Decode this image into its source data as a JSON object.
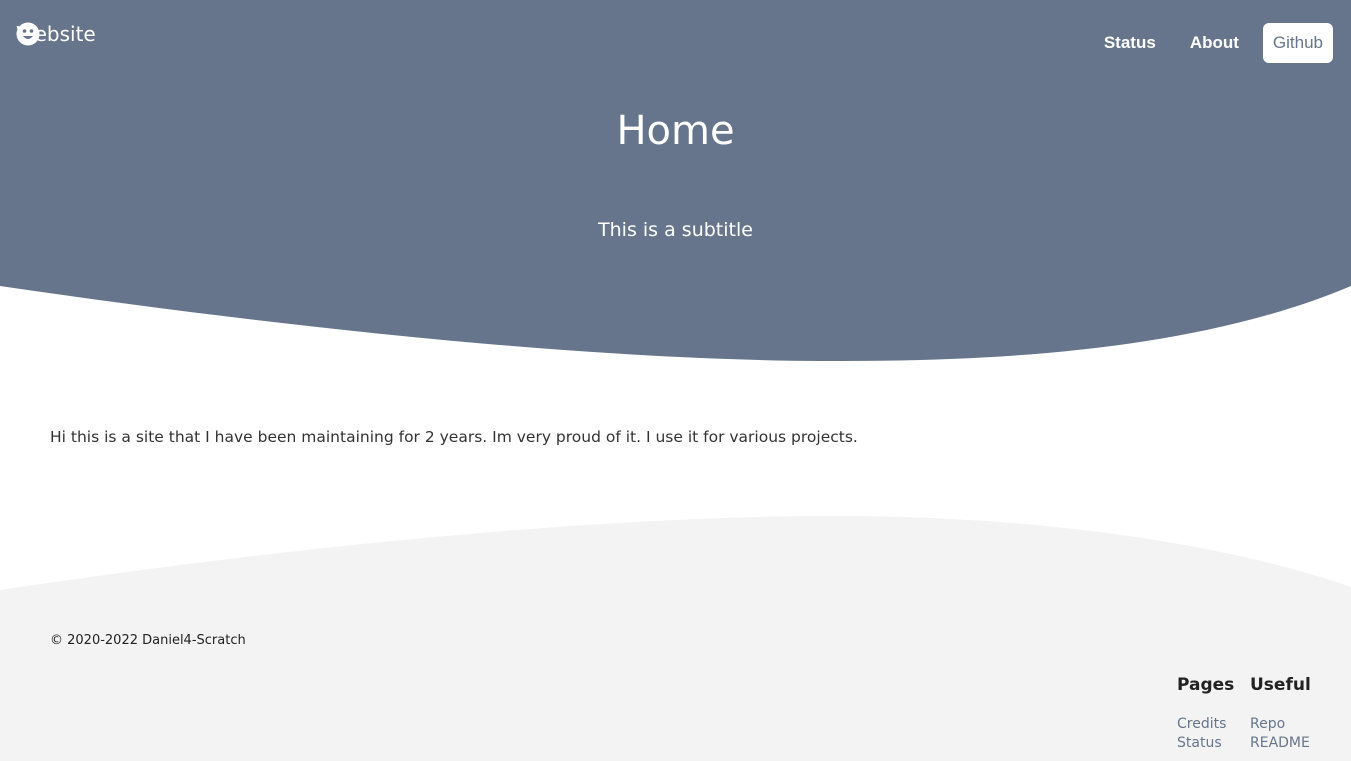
{
  "colors": {
    "brand": "#66758c",
    "footer_bg": "#f3f3f3",
    "text": "#333333"
  },
  "header": {
    "site_name": "Website",
    "logo_icon": "smiley-icon",
    "nav": [
      {
        "label": "Status"
      },
      {
        "label": "About"
      },
      {
        "label": "Github"
      }
    ]
  },
  "hero": {
    "title": "Home",
    "subtitle": "This is a subtitle"
  },
  "main": {
    "text": "Hi this is a site that I have been maintaining for 2 years. Im very proud of it. I use it for various projects."
  },
  "footer": {
    "copyright": "© 2020-2022 Daniel4-Scratch",
    "columns": [
      {
        "heading": "Pages",
        "links": [
          "Credits",
          "Status"
        ]
      },
      {
        "heading": "Useful",
        "links": [
          "Repo",
          "README"
        ]
      }
    ]
  }
}
